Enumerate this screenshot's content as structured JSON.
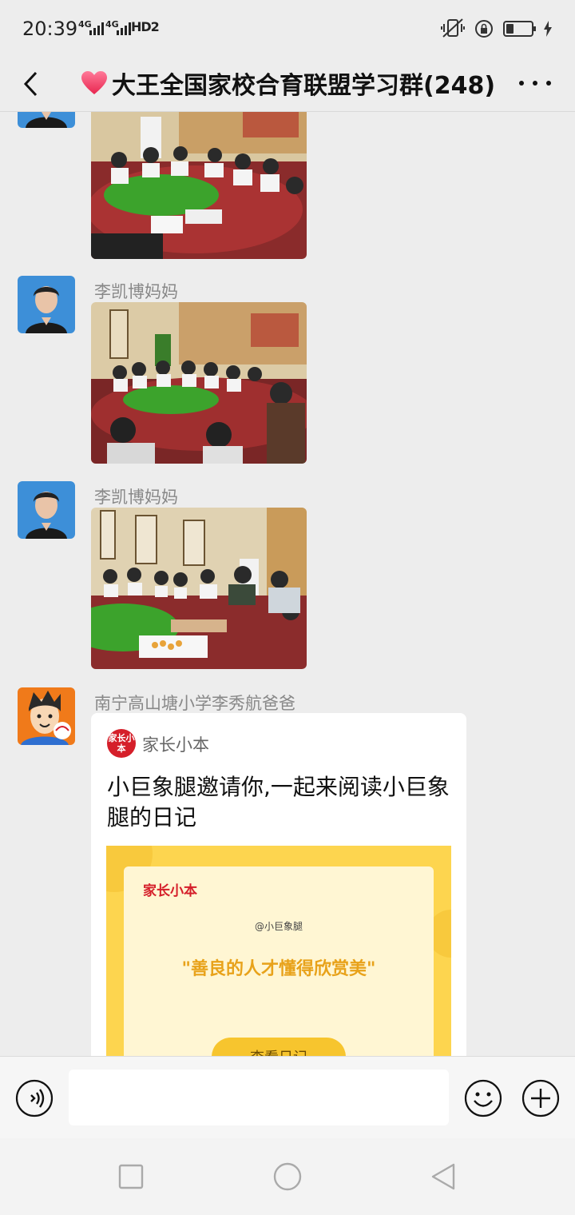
{
  "status_bar": {
    "time": "20:39",
    "network_1": "4G",
    "network_2": "4G",
    "hd_badge": "HD2",
    "battery_level": 0.3
  },
  "nav": {
    "title": "大王全国家校合育联盟学习群(248)",
    "back_icon": "chevron-left-icon",
    "more_icon": "more-dots-icon"
  },
  "messages": [
    {
      "sender": "",
      "type": "image",
      "image": "banquet-photo"
    },
    {
      "sender": "李凯博妈妈",
      "type": "image",
      "image": "banquet-photo"
    },
    {
      "sender": "李凯博妈妈",
      "type": "image",
      "image": "banquet-photo"
    },
    {
      "sender": "南宁高山塘小学李秀航爸爸",
      "type": "link-card",
      "card": {
        "app_logo_text": "家长小本",
        "app_name": "家长小本",
        "title": "小巨象腿邀请你,一起来阅读小巨象腿的日记",
        "thumb_logo": "家长小本",
        "thumb_handle": "@小巨象腿",
        "thumb_quote": "\"善良的人才懂得欣赏美\"",
        "thumb_button": "查看日记"
      }
    }
  ],
  "input_bar": {
    "placeholder": "",
    "voice_icon": "voice-icon",
    "emoji_icon": "emoji-icon",
    "plus_icon": "plus-icon"
  },
  "colors": {
    "background": "#ededed",
    "card_brand": "#d51f2a",
    "thumb_yellow": "#fdd54f"
  }
}
